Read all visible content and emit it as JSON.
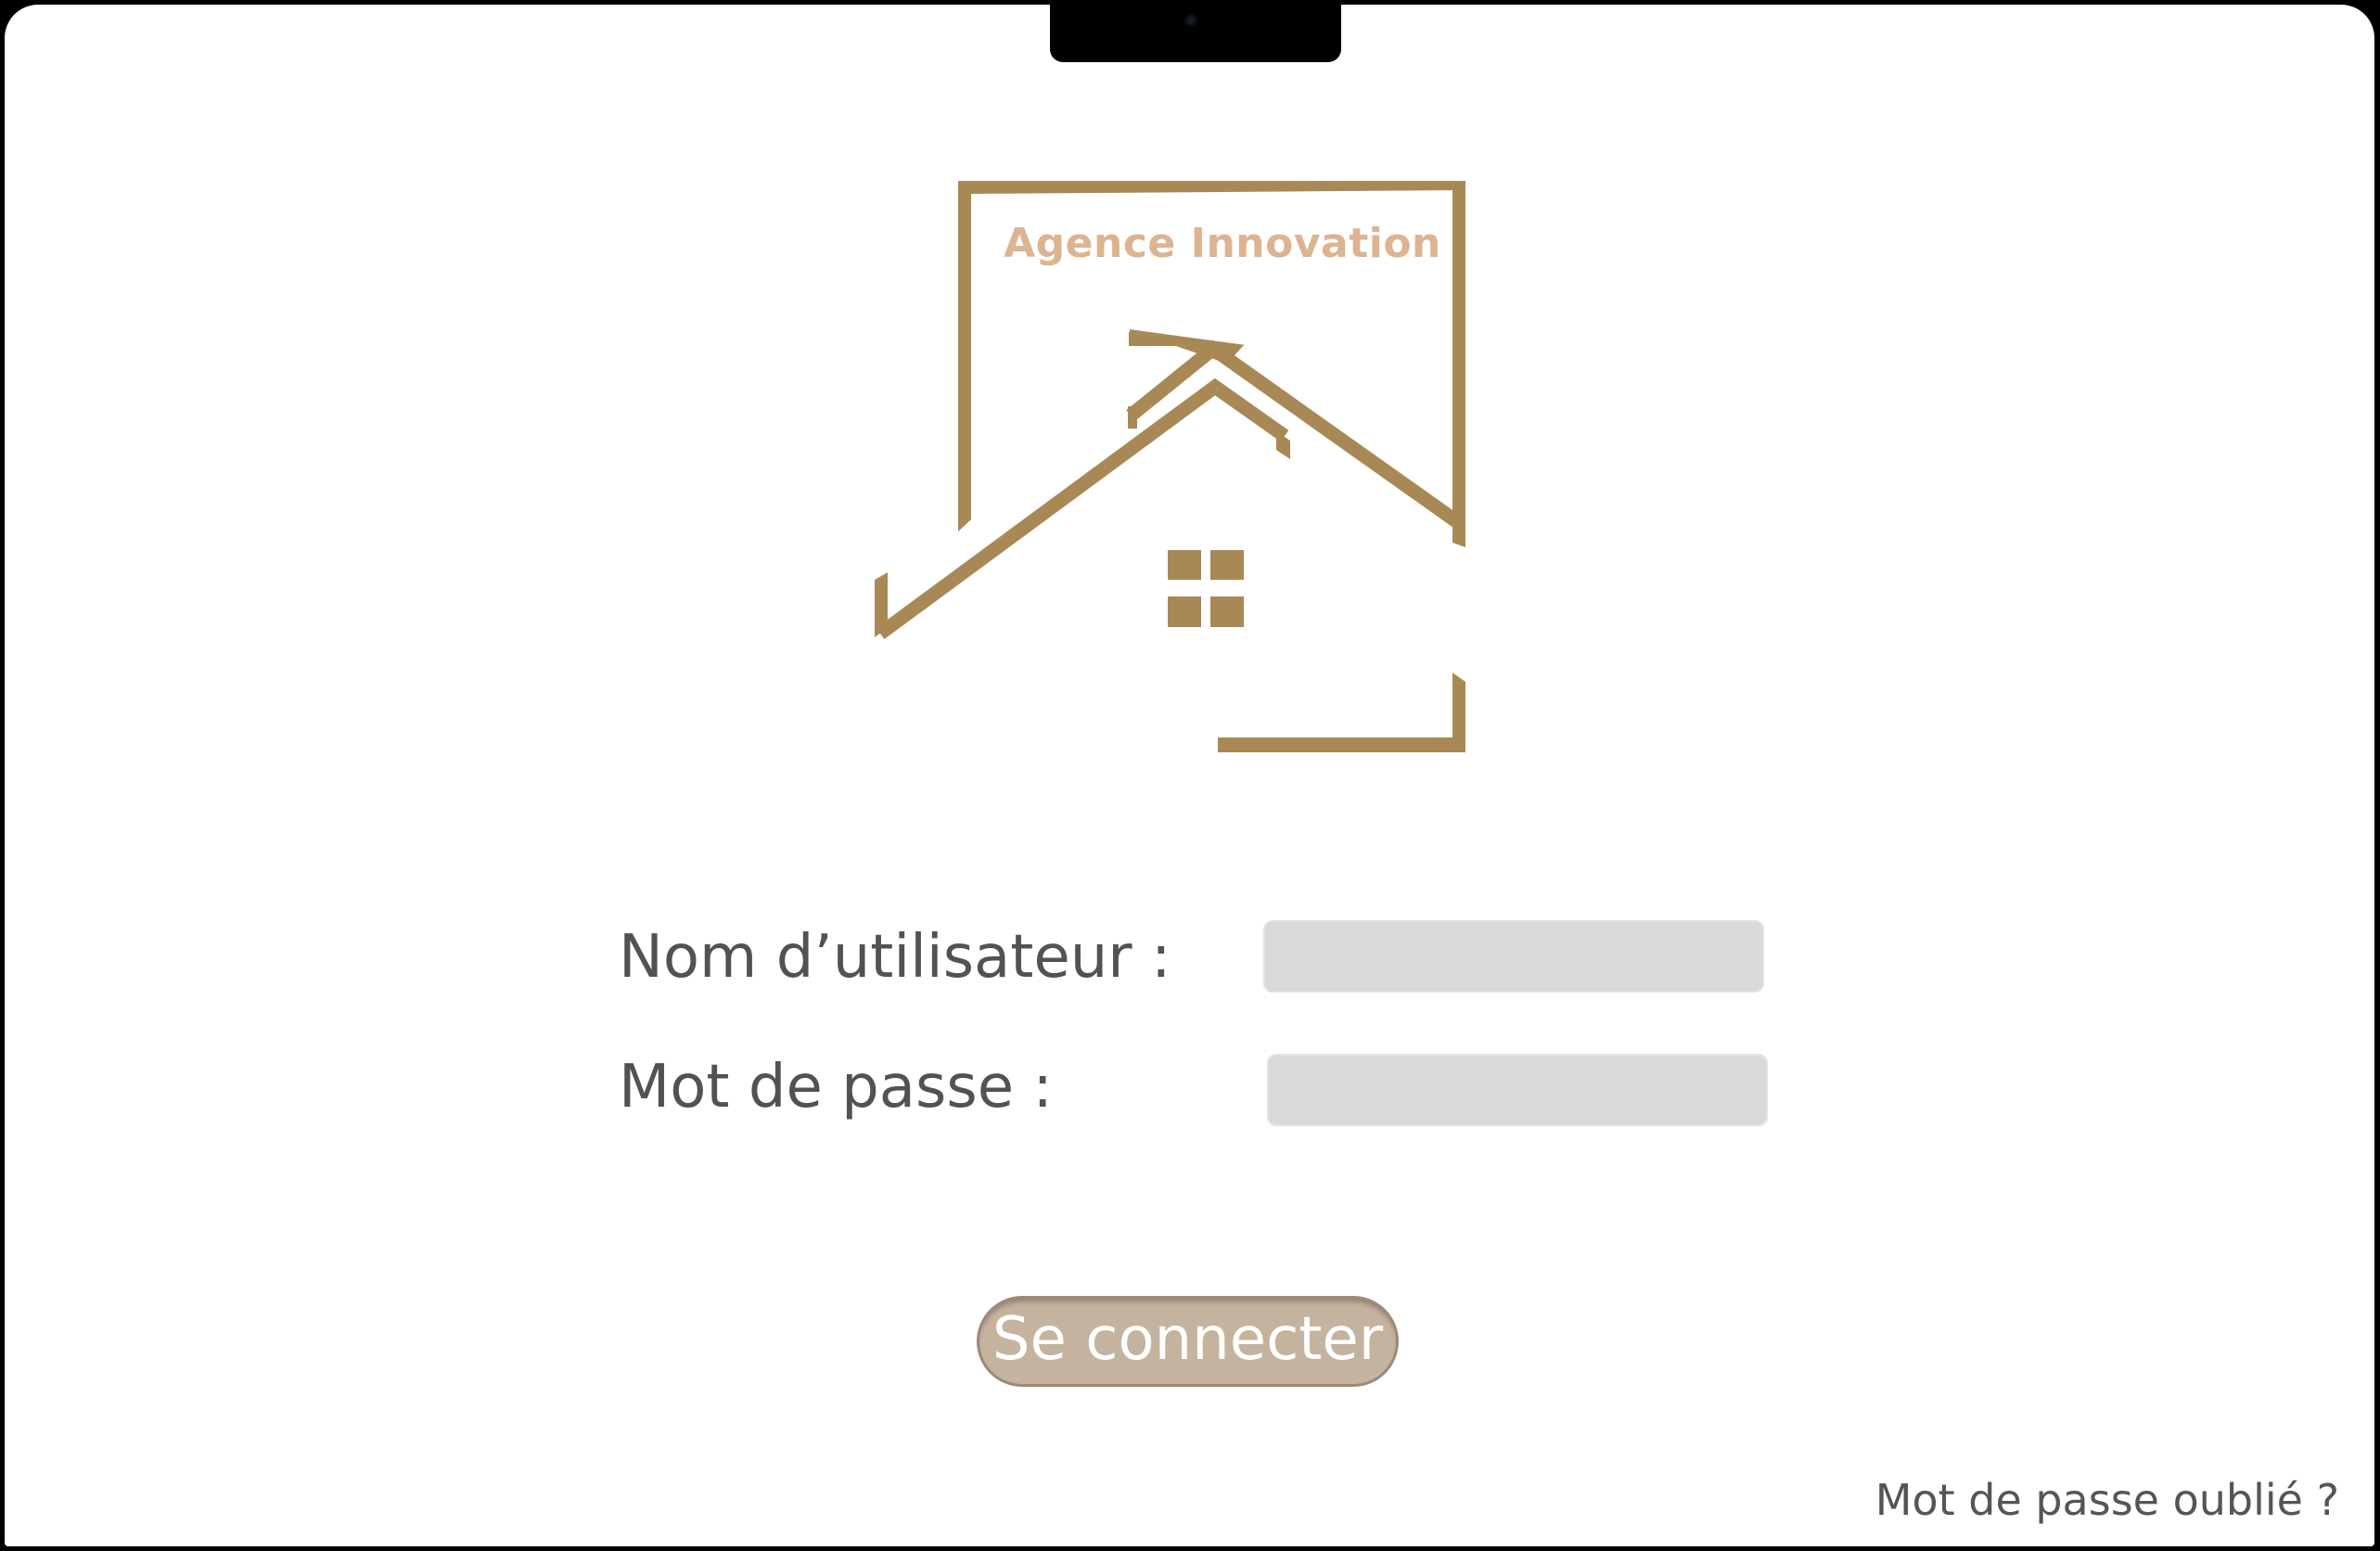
{
  "brand": {
    "name": "Agence Innovation",
    "logo_color": "#a88855",
    "name_color": "#dcb491"
  },
  "login_form": {
    "username_label": "Nom d’utilisateur :",
    "username_value": "",
    "password_label": "Mot de passe :",
    "password_value": "",
    "submit_label": "Se connecter"
  },
  "forgot_password": {
    "label": "Mot de passe oublié ?"
  },
  "colors": {
    "background": "#ffffff",
    "text": "#525252",
    "field_fill": "#d9d9d9",
    "button_fill": "#c4b49f"
  }
}
